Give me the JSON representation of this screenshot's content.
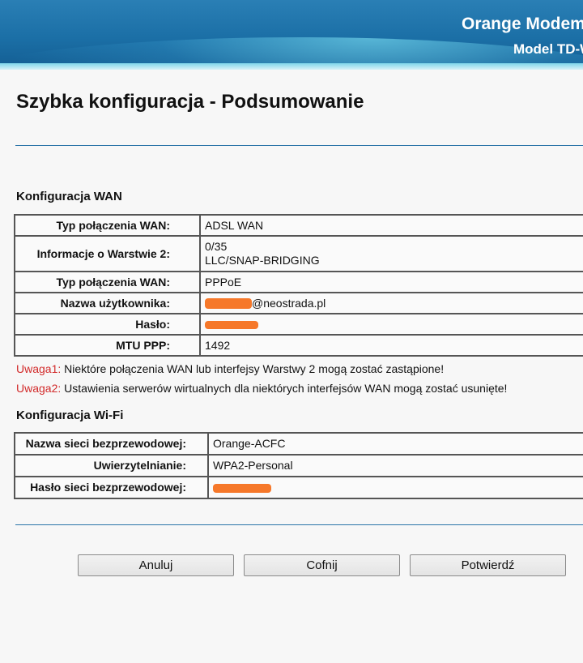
{
  "header": {
    "title": "Orange Modem",
    "model": "Model TD-W",
    "colors": {
      "bar": "#1b6fa6",
      "strip": "#7fd6ea"
    }
  },
  "page": {
    "title": "Szybka konfiguracja - Podsumowanie"
  },
  "wan": {
    "section_title": "Konfiguracja WAN",
    "rows": [
      {
        "label": "Typ połączenia WAN:",
        "value": "ADSL WAN"
      },
      {
        "label": "Informacje o Warstwie 2:",
        "value_line1": "0/35",
        "value_line2": "LLC/SNAP-BRIDGING"
      },
      {
        "label": "Typ połączenia WAN:",
        "value": "PPPoE"
      },
      {
        "label": "Nazwa użytkownika:",
        "value_suffix": "@neostrada.pl"
      },
      {
        "label": "Hasło:"
      },
      {
        "label": "MTU PPP:",
        "value": "1492"
      }
    ],
    "notes": [
      {
        "tag": "Uwaga1:",
        "text": " Niektóre połączenia WAN lub interfejsy Warstwy 2 mogą zostać zastąpione!"
      },
      {
        "tag": "Uwaga2:",
        "text": " Ustawienia serwerów wirtualnych dla niektórych interfejsów WAN mogą zostać usunięte!"
      }
    ],
    "warn_color": "#d22a2a"
  },
  "wifi": {
    "section_title": "Konfiguracja Wi-Fi",
    "rows": [
      {
        "label": "Nazwa sieci bezprzewodowej:",
        "value": "Orange-ACFC"
      },
      {
        "label": "Uwierzytelnianie:",
        "value": "WPA2-Personal"
      },
      {
        "label": "Hasło sieci bezprzewodowej:"
      }
    ]
  },
  "buttons": {
    "cancel": "Anuluj",
    "back": "Cofnij",
    "confirm": "Potwierdź"
  },
  "redaction_color": "#f6782a"
}
